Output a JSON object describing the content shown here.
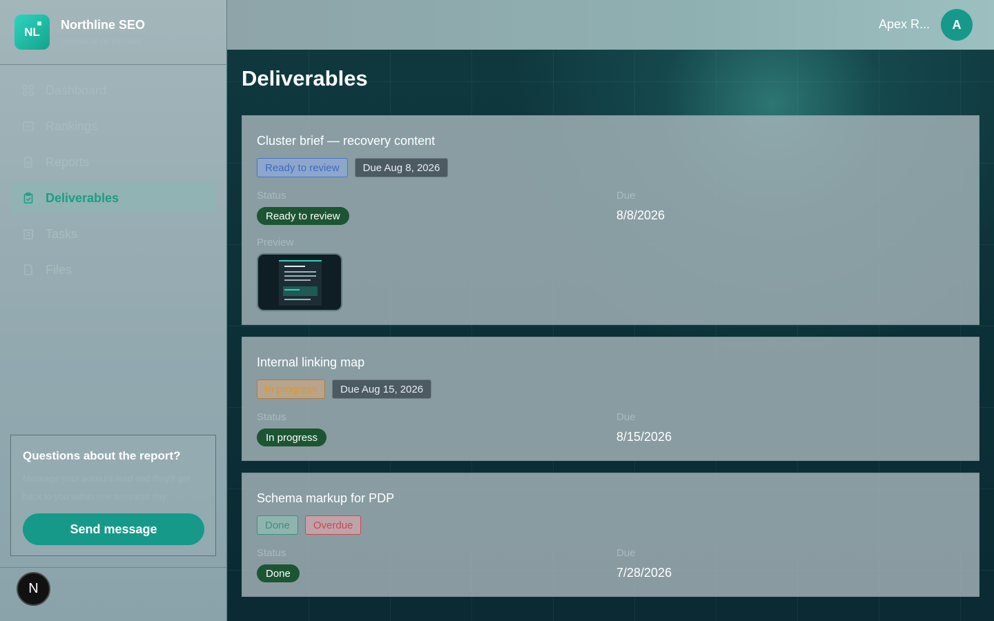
{
  "brand": {
    "logo_text": "NL",
    "name": "Northline SEO",
    "subtitle": "Seasonal re-Portalis"
  },
  "nav": {
    "items": [
      {
        "label": "Dashboard",
        "icon": "grid-icon"
      },
      {
        "label": "Rankings",
        "icon": "chart-icon"
      },
      {
        "label": "Reports",
        "icon": "document-icon"
      },
      {
        "label": "Deliverables",
        "icon": "clipboard-icon",
        "active": true
      },
      {
        "label": "Tasks",
        "icon": "checklist-icon"
      },
      {
        "label": "Files",
        "icon": "folder-icon"
      }
    ]
  },
  "help": {
    "title": "Questions about the report?",
    "text": "Message your account lead and they'll get back to you within one business day.",
    "button_label": "Send message"
  },
  "footer_badge": "N",
  "topbar": {
    "account_name": "Apex R...",
    "avatar_initial": "A"
  },
  "page": {
    "title": "Deliverables"
  },
  "deliverables": [
    {
      "title": "Cluster brief — recovery content",
      "tags": [
        "Ready to review",
        "Due Aug 8, 2026"
      ],
      "status_label": "Status",
      "status": "Ready to review",
      "due_label": "Due",
      "due": "8/8/2026",
      "preview_label": "Preview"
    },
    {
      "title": "Internal linking map",
      "tags": [
        "In progress",
        "Due Aug 15, 2026"
      ],
      "status_label": "Status",
      "status": "In progress",
      "due_label": "Due",
      "due": "8/15/2026"
    },
    {
      "title": "Schema markup for PDP",
      "tags": [
        "Done",
        "Overdue"
      ],
      "status_label": "Status",
      "status": "Done",
      "due_label": "Due",
      "due": "7/28/2026"
    }
  ],
  "colors": {
    "accent": "#17998a",
    "sidebar_active_text": "#1a9e86",
    "status_pill": "#1b5532"
  }
}
